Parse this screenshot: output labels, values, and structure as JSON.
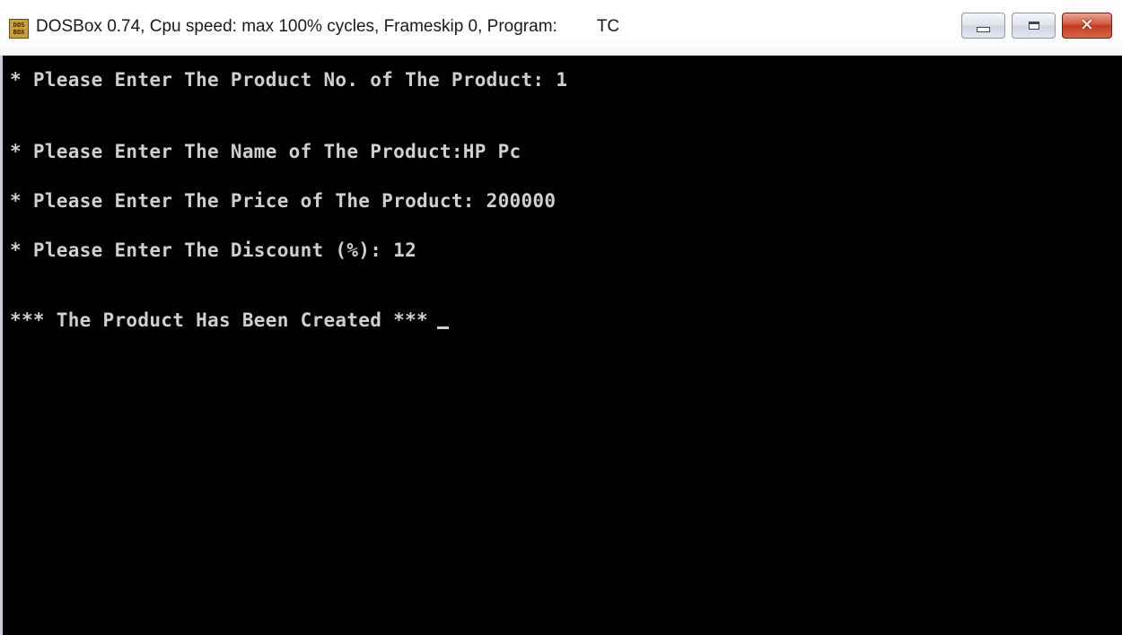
{
  "window": {
    "title": "DOSBox 0.74, Cpu speed: max 100% cycles, Frameskip  0, Program:",
    "program": "TC",
    "icon": "dosbox-icon",
    "icon_text_top": "DOS",
    "icon_text_bottom": "BOX"
  },
  "controls": {
    "minimize": "minimize-icon",
    "maximize": "maximize-icon",
    "close": "close-icon",
    "close_glyph": "✕"
  },
  "console": {
    "lines": [
      "* Please Enter The Product No. of The Product: 1",
      "* Please Enter The Name of The Product:HP Pc",
      "* Please Enter The Price of The Product: 200000",
      "* Please Enter The Discount (%): 12",
      "*** The Product Has Been Created ***"
    ]
  },
  "colors": {
    "console_background": "#000000",
    "console_text": "#cfcfcf",
    "close_button": "#c23a1f"
  }
}
